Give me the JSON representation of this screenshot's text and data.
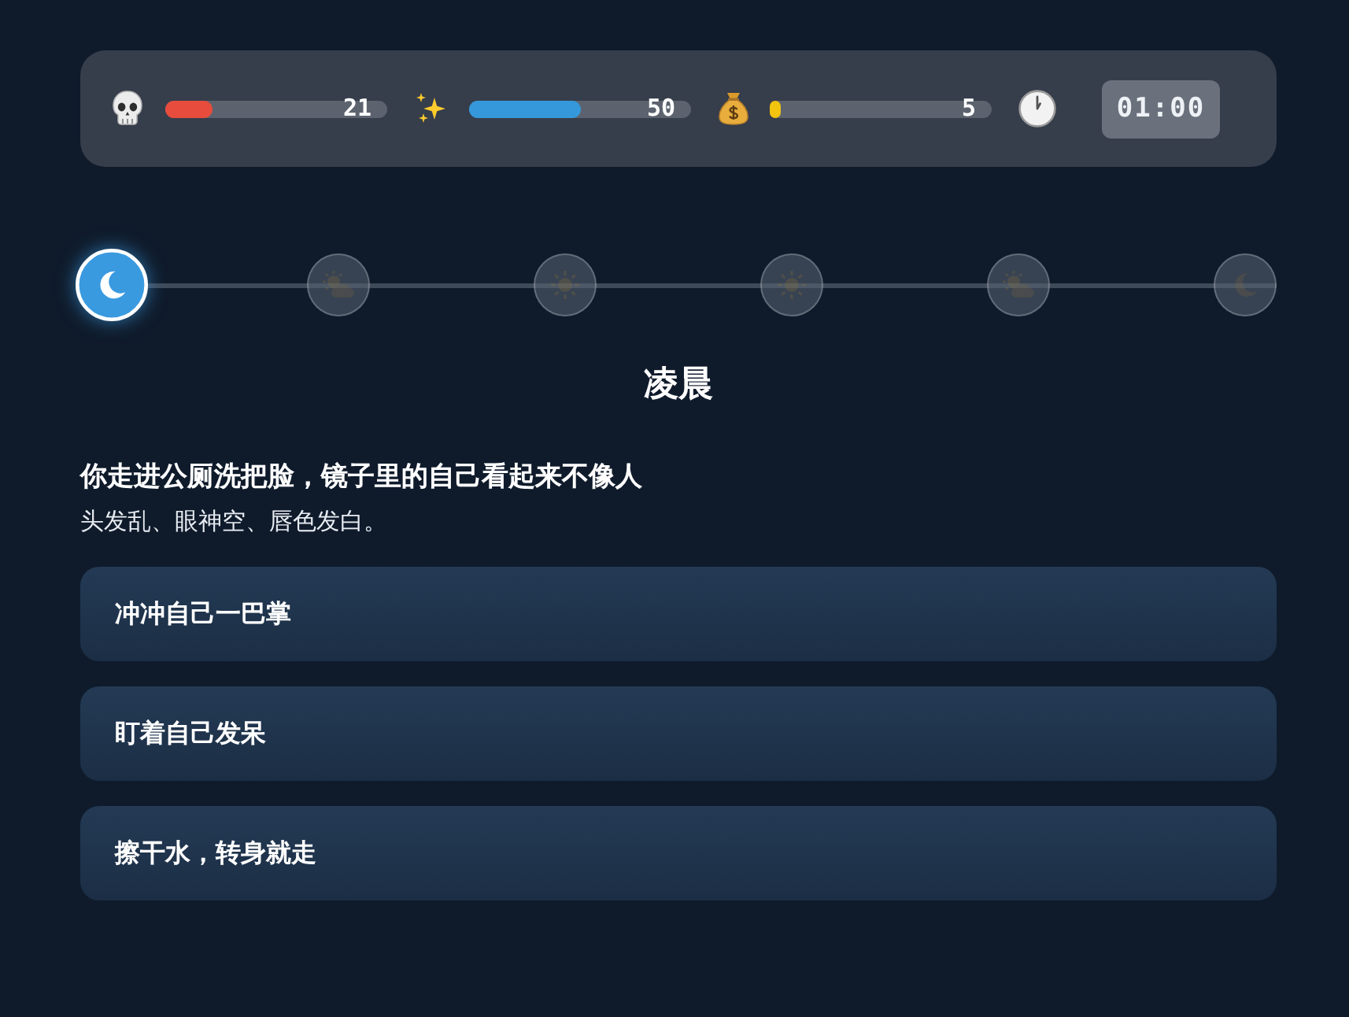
{
  "stats": [
    {
      "kind": "skull",
      "reading": "21",
      "level": 0.21,
      "color": "#e74c3c"
    },
    {
      "kind": "sparkles",
      "reading": "50",
      "level": 0.5,
      "color": "#3498db"
    },
    {
      "kind": "money",
      "reading": "5",
      "level": 0.05,
      "color": "#f1c40f"
    }
  ],
  "timer": "01:00",
  "timeline": [
    {
      "kind": "moon",
      "selected": true
    },
    {
      "kind": "sun-cloud",
      "selected": false
    },
    {
      "kind": "sun",
      "selected": false
    },
    {
      "kind": "sun",
      "selected": false
    },
    {
      "kind": "sun-cloud",
      "selected": false
    },
    {
      "kind": "moon",
      "selected": false
    }
  ],
  "time_of_day": "凌晨",
  "scene": {
    "headline": "你走进公厕洗把脸，镜子里的自己看起来不像人",
    "detail": "头发乱、眼神空、唇色发白。"
  },
  "choices": [
    "冲冲自己一巴掌",
    "盯着自己发呆",
    "擦干水，转身就走"
  ]
}
